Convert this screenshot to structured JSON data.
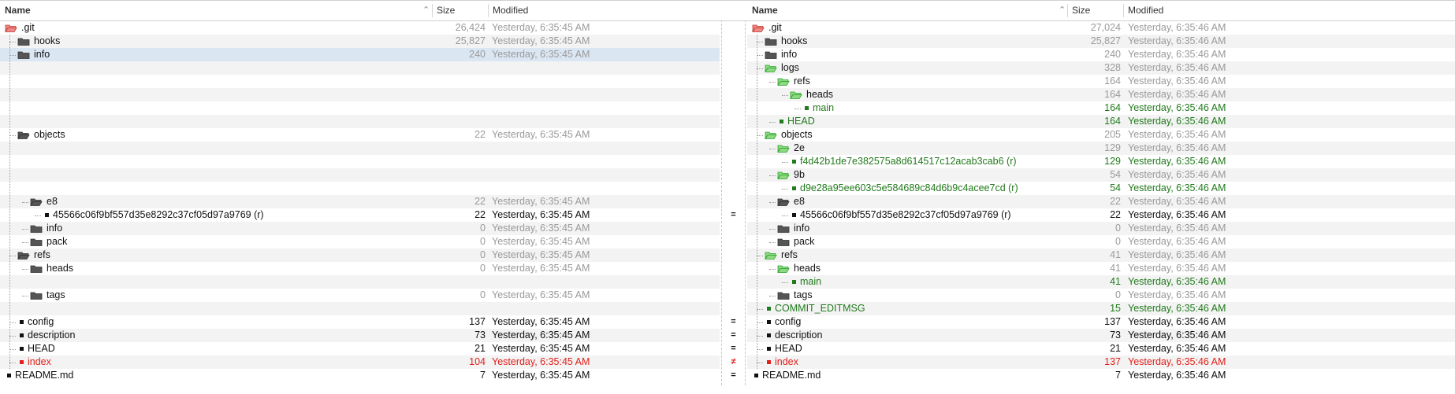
{
  "header": {
    "name": "Name",
    "size": "Size",
    "modified": "Modified"
  },
  "colors": {
    "folder_gray": "#555555",
    "folder_green": "#2aa52a",
    "folder_red": "#c0392b",
    "green_text": "#217a1c",
    "red_text": "#e0201b",
    "selection": "#dbe6f3"
  },
  "left": {
    "rows": [
      {
        "label": ".git",
        "size": "26,424",
        "modified": "Yesterday, 6:35:45 AM",
        "icon": "folder-red-open-icon",
        "depth": 0,
        "style": "muted",
        "nameStyle": "black"
      },
      {
        "label": "hooks",
        "size": "25,827",
        "modified": "Yesterday, 6:35:45 AM",
        "icon": "folder-gray-icon",
        "depth": 1,
        "style": "muted",
        "nameStyle": "black"
      },
      {
        "label": "info",
        "size": "240",
        "modified": "Yesterday, 6:35:45 AM",
        "icon": "folder-gray-icon",
        "depth": 1,
        "style": "muted",
        "nameStyle": "black",
        "selected": true
      },
      {
        "empty": true
      },
      {
        "empty": true
      },
      {
        "empty": true
      },
      {
        "empty": true
      },
      {
        "empty": true
      },
      {
        "label": "objects",
        "size": "22",
        "modified": "Yesterday, 6:35:45 AM",
        "icon": "folder-gray-open-icon",
        "depth": 1,
        "style": "muted",
        "nameStyle": "black"
      },
      {
        "empty": true
      },
      {
        "empty": true
      },
      {
        "empty": true
      },
      {
        "empty": true
      },
      {
        "label": "e8",
        "size": "22",
        "modified": "Yesterday, 6:35:45 AM",
        "icon": "folder-gray-open-icon",
        "depth": 2,
        "style": "muted",
        "nameStyle": "black"
      },
      {
        "label": "45566c06f9bf557d35e8292c37cf05d97a9769 (r)",
        "size": "22",
        "modified": "Yesterday, 6:35:45 AM",
        "icon": "file-black-icon",
        "depth": 3,
        "style": "black",
        "nameStyle": "black"
      },
      {
        "label": "info",
        "size": "0",
        "modified": "Yesterday, 6:35:45 AM",
        "icon": "folder-gray-icon",
        "depth": 2,
        "style": "muted",
        "nameStyle": "black"
      },
      {
        "label": "pack",
        "size": "0",
        "modified": "Yesterday, 6:35:45 AM",
        "icon": "folder-gray-icon",
        "depth": 2,
        "style": "muted",
        "nameStyle": "black"
      },
      {
        "label": "refs",
        "size": "0",
        "modified": "Yesterday, 6:35:45 AM",
        "icon": "folder-gray-open-icon",
        "depth": 1,
        "style": "muted",
        "nameStyle": "black"
      },
      {
        "label": "heads",
        "size": "0",
        "modified": "Yesterday, 6:35:45 AM",
        "icon": "folder-gray-icon",
        "depth": 2,
        "style": "muted",
        "nameStyle": "black"
      },
      {
        "empty": true
      },
      {
        "label": "tags",
        "size": "0",
        "modified": "Yesterday, 6:35:45 AM",
        "icon": "folder-gray-icon",
        "depth": 2,
        "style": "muted",
        "nameStyle": "black"
      },
      {
        "empty": true
      },
      {
        "label": "config",
        "size": "137",
        "modified": "Yesterday, 6:35:45 AM",
        "icon": "file-black-icon",
        "depth": 1,
        "style": "black",
        "nameStyle": "black"
      },
      {
        "label": "description",
        "size": "73",
        "modified": "Yesterday, 6:35:45 AM",
        "icon": "file-black-icon",
        "depth": 1,
        "style": "black",
        "nameStyle": "black"
      },
      {
        "label": "HEAD",
        "size": "21",
        "modified": "Yesterday, 6:35:45 AM",
        "icon": "file-black-icon",
        "depth": 1,
        "style": "black",
        "nameStyle": "black"
      },
      {
        "label": "index",
        "size": "104",
        "modified": "Yesterday, 6:35:45 AM",
        "icon": "file-red-icon",
        "depth": 1,
        "style": "red",
        "nameStyle": "red"
      },
      {
        "label": "README.md",
        "size": "7",
        "modified": "Yesterday, 6:35:45 AM",
        "icon": "file-black-icon",
        "depth": 0,
        "style": "black",
        "nameStyle": "black"
      }
    ]
  },
  "right": {
    "rows": [
      {
        "label": ".git",
        "size": "27,024",
        "modified": "Yesterday, 6:35:46 AM",
        "icon": "folder-red-open-icon",
        "depth": 0,
        "style": "muted",
        "nameStyle": "black"
      },
      {
        "label": "hooks",
        "size": "25,827",
        "modified": "Yesterday, 6:35:46 AM",
        "icon": "folder-gray-icon",
        "depth": 1,
        "style": "muted",
        "nameStyle": "black"
      },
      {
        "label": "info",
        "size": "240",
        "modified": "Yesterday, 6:35:46 AM",
        "icon": "folder-gray-icon",
        "depth": 1,
        "style": "muted",
        "nameStyle": "black"
      },
      {
        "label": "logs",
        "size": "328",
        "modified": "Yesterday, 6:35:46 AM",
        "icon": "folder-green-open-icon",
        "depth": 1,
        "style": "muted",
        "nameStyle": "black"
      },
      {
        "label": "refs",
        "size": "164",
        "modified": "Yesterday, 6:35:46 AM",
        "icon": "folder-green-open-icon",
        "depth": 2,
        "style": "muted",
        "nameStyle": "black"
      },
      {
        "label": "heads",
        "size": "164",
        "modified": "Yesterday, 6:35:46 AM",
        "icon": "folder-green-open-icon",
        "depth": 3,
        "style": "muted",
        "nameStyle": "black"
      },
      {
        "label": "main",
        "size": "164",
        "modified": "Yesterday, 6:35:46 AM",
        "icon": "file-green-icon",
        "depth": 4,
        "style": "green",
        "nameStyle": "green"
      },
      {
        "label": "HEAD",
        "size": "164",
        "modified": "Yesterday, 6:35:46 AM",
        "icon": "file-green-icon",
        "depth": 2,
        "style": "green",
        "nameStyle": "green"
      },
      {
        "label": "objects",
        "size": "205",
        "modified": "Yesterday, 6:35:46 AM",
        "icon": "folder-green-open-icon",
        "depth": 1,
        "style": "muted",
        "nameStyle": "black"
      },
      {
        "label": "2e",
        "size": "129",
        "modified": "Yesterday, 6:35:46 AM",
        "icon": "folder-green-open-icon",
        "depth": 2,
        "style": "muted",
        "nameStyle": "black"
      },
      {
        "label": "f4d42b1de7e382575a8d614517c12acab3cab6 (r)",
        "size": "129",
        "modified": "Yesterday, 6:35:46 AM",
        "icon": "file-green-icon",
        "depth": 3,
        "style": "green",
        "nameStyle": "green"
      },
      {
        "label": "9b",
        "size": "54",
        "modified": "Yesterday, 6:35:46 AM",
        "icon": "folder-green-open-icon",
        "depth": 2,
        "style": "muted",
        "nameStyle": "black"
      },
      {
        "label": "d9e28a95ee603c5e584689c84d6b9c4acee7cd (r)",
        "size": "54",
        "modified": "Yesterday, 6:35:46 AM",
        "icon": "file-green-icon",
        "depth": 3,
        "style": "green",
        "nameStyle": "green"
      },
      {
        "label": "e8",
        "size": "22",
        "modified": "Yesterday, 6:35:46 AM",
        "icon": "folder-gray-open-icon",
        "depth": 2,
        "style": "muted",
        "nameStyle": "black"
      },
      {
        "label": "45566c06f9bf557d35e8292c37cf05d97a9769 (r)",
        "size": "22",
        "modified": "Yesterday, 6:35:46 AM",
        "icon": "file-black-icon",
        "depth": 3,
        "style": "black",
        "nameStyle": "black"
      },
      {
        "label": "info",
        "size": "0",
        "modified": "Yesterday, 6:35:46 AM",
        "icon": "folder-gray-icon",
        "depth": 2,
        "style": "muted",
        "nameStyle": "black"
      },
      {
        "label": "pack",
        "size": "0",
        "modified": "Yesterday, 6:35:46 AM",
        "icon": "folder-gray-icon",
        "depth": 2,
        "style": "muted",
        "nameStyle": "black"
      },
      {
        "label": "refs",
        "size": "41",
        "modified": "Yesterday, 6:35:46 AM",
        "icon": "folder-green-open-icon",
        "depth": 1,
        "style": "muted",
        "nameStyle": "black"
      },
      {
        "label": "heads",
        "size": "41",
        "modified": "Yesterday, 6:35:46 AM",
        "icon": "folder-green-open-icon",
        "depth": 2,
        "style": "muted",
        "nameStyle": "black"
      },
      {
        "label": "main",
        "size": "41",
        "modified": "Yesterday, 6:35:46 AM",
        "icon": "file-green-icon",
        "depth": 3,
        "style": "green",
        "nameStyle": "green"
      },
      {
        "label": "tags",
        "size": "0",
        "modified": "Yesterday, 6:35:46 AM",
        "icon": "folder-gray-icon",
        "depth": 2,
        "style": "muted",
        "nameStyle": "black"
      },
      {
        "label": "COMMIT_EDITMSG",
        "size": "15",
        "modified": "Yesterday, 6:35:46 AM",
        "icon": "file-green-icon",
        "depth": 1,
        "style": "green",
        "nameStyle": "green"
      },
      {
        "label": "config",
        "size": "137",
        "modified": "Yesterday, 6:35:46 AM",
        "icon": "file-black-icon",
        "depth": 1,
        "style": "black",
        "nameStyle": "black"
      },
      {
        "label": "description",
        "size": "73",
        "modified": "Yesterday, 6:35:46 AM",
        "icon": "file-black-icon",
        "depth": 1,
        "style": "black",
        "nameStyle": "black"
      },
      {
        "label": "HEAD",
        "size": "21",
        "modified": "Yesterday, 6:35:46 AM",
        "icon": "file-black-icon",
        "depth": 1,
        "style": "black",
        "nameStyle": "black"
      },
      {
        "label": "index",
        "size": "137",
        "modified": "Yesterday, 6:35:46 AM",
        "icon": "file-red-icon",
        "depth": 1,
        "style": "red",
        "nameStyle": "red"
      },
      {
        "label": "README.md",
        "size": "7",
        "modified": "Yesterday, 6:35:46 AM",
        "icon": "file-black-icon",
        "depth": 0,
        "style": "black",
        "nameStyle": "black"
      }
    ]
  },
  "gutter": [
    {
      "mark": "",
      "icon": ""
    },
    {
      "mark": "",
      "icon": ""
    },
    {
      "mark": "",
      "icon": ""
    },
    {
      "mark": "",
      "icon": ""
    },
    {
      "mark": "",
      "icon": ""
    },
    {
      "mark": "",
      "icon": ""
    },
    {
      "mark": "",
      "icon": ""
    },
    {
      "mark": "",
      "icon": ""
    },
    {
      "mark": "",
      "icon": ""
    },
    {
      "mark": "",
      "icon": ""
    },
    {
      "mark": "",
      "icon": ""
    },
    {
      "mark": "",
      "icon": ""
    },
    {
      "mark": "",
      "icon": ""
    },
    {
      "mark": "",
      "icon": ""
    },
    {
      "mark": "=",
      "icon": "equal-icon"
    },
    {
      "mark": "",
      "icon": ""
    },
    {
      "mark": "",
      "icon": ""
    },
    {
      "mark": "",
      "icon": ""
    },
    {
      "mark": "",
      "icon": ""
    },
    {
      "mark": "",
      "icon": ""
    },
    {
      "mark": "",
      "icon": ""
    },
    {
      "mark": "",
      "icon": ""
    },
    {
      "mark": "=",
      "icon": "equal-icon"
    },
    {
      "mark": "=",
      "icon": "equal-icon"
    },
    {
      "mark": "=",
      "icon": "equal-icon"
    },
    {
      "mark": "≠",
      "icon": "not-equal-icon"
    },
    {
      "mark": "=",
      "icon": "equal-icon"
    }
  ]
}
